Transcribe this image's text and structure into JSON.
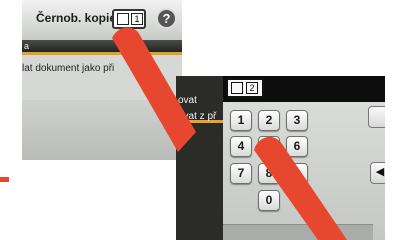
{
  "left_screen": {
    "title": "Černob. kopie:",
    "copy_digits": [
      "",
      "1"
    ],
    "help_icon": "?",
    "menu_text": "a",
    "row_text": "lat dokument jako při"
  },
  "right_screen": {
    "menu_items": [
      "ovat",
      "ovat z př"
    ],
    "input_digits": [
      "",
      "2"
    ],
    "keys": [
      "1",
      "2",
      "3",
      "4",
      "5",
      "6",
      "7",
      "8",
      "9",
      "0"
    ],
    "backspace_icon": "◀"
  },
  "colors": {
    "pointer_red": "#e8472f",
    "highlight_stripe": "#e2a12a"
  }
}
